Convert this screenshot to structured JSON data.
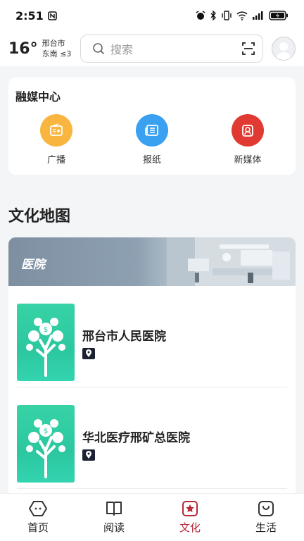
{
  "status_bar": {
    "time": "2:51"
  },
  "header": {
    "temperature": "16°",
    "city": "邢台市",
    "wind": "东南 ≤3",
    "search_placeholder": "搜索"
  },
  "media_center": {
    "title": "融媒中心",
    "items": [
      {
        "label": "广播",
        "icon": "radio-icon",
        "color": "#f8b640"
      },
      {
        "label": "报纸",
        "icon": "newspaper-icon",
        "color": "#3aa0f0"
      },
      {
        "label": "新媒体",
        "icon": "new-media-icon",
        "color": "#e13a32"
      }
    ]
  },
  "culture_map": {
    "title": "文化地图",
    "category": "医院",
    "hospitals": [
      {
        "name": "邢台市人民医院"
      },
      {
        "name": "华北医疗邢矿总医院"
      }
    ]
  },
  "tabbar": {
    "tabs": [
      {
        "label": "首页",
        "icon": "home-icon",
        "active": false
      },
      {
        "label": "阅读",
        "icon": "book-icon",
        "active": false
      },
      {
        "label": "文化",
        "icon": "culture-star-icon",
        "active": true
      },
      {
        "label": "生活",
        "icon": "life-bag-icon",
        "active": false
      }
    ],
    "active_color": "#b7283a"
  }
}
